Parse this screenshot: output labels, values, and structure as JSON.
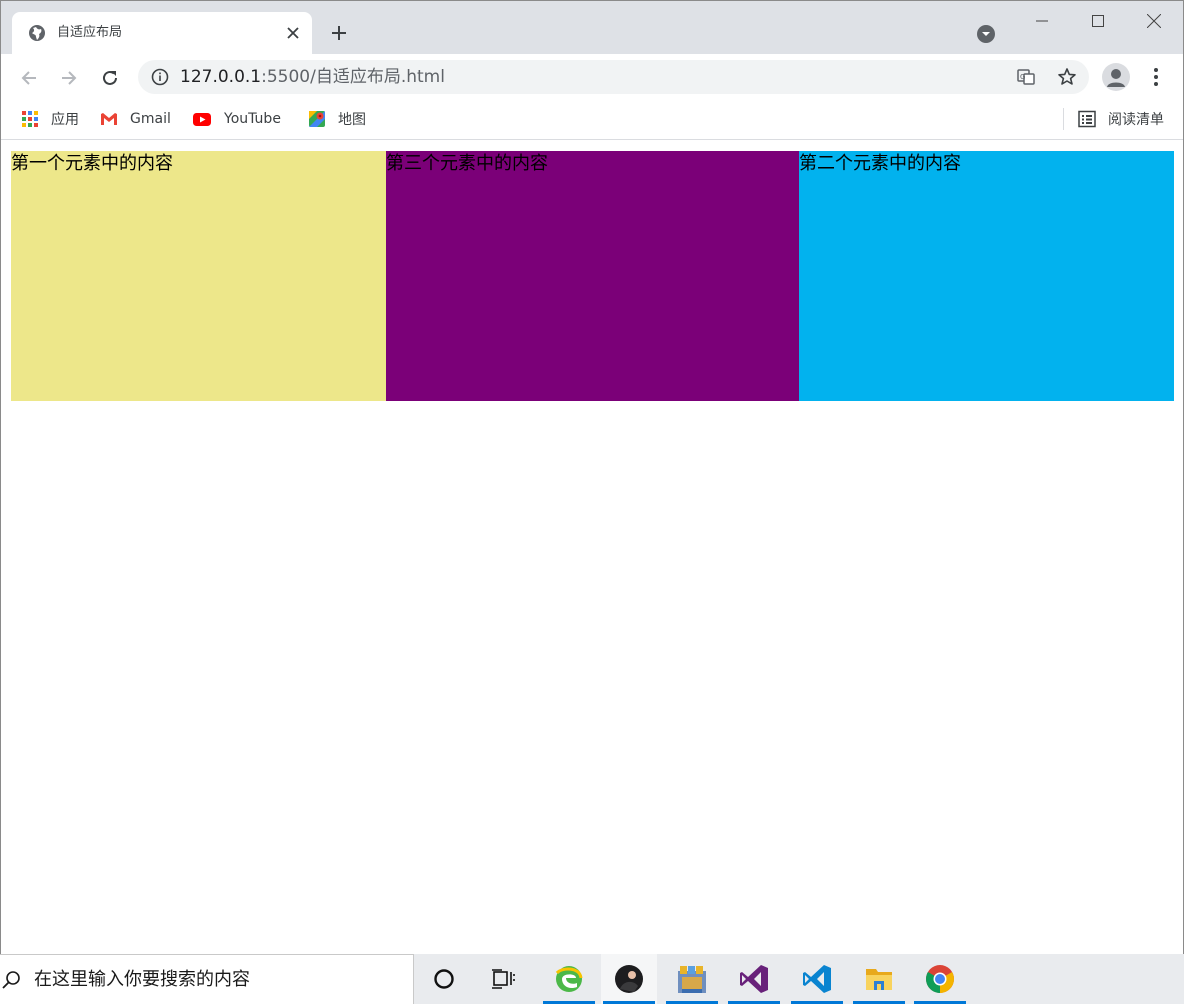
{
  "browser": {
    "tab": {
      "title": "自适应布局"
    },
    "address": {
      "host": "127.0.0.1",
      "path": ":5500/自适应布局.html"
    },
    "bookmarks": [
      {
        "label": "应用",
        "icon": "apps-grid-icon"
      },
      {
        "label": "Gmail",
        "icon": "gmail-icon"
      },
      {
        "label": "YouTube",
        "icon": "youtube-icon"
      },
      {
        "label": "地图",
        "icon": "maps-icon"
      }
    ],
    "reading_list": {
      "label": "阅读清单"
    }
  },
  "page": {
    "boxes": [
      {
        "text": "第一个元素中的内容",
        "color": "#ede78a"
      },
      {
        "text": "第三个元素中的内容",
        "color": "#7b0078"
      },
      {
        "text": "第二个元素中的内容",
        "color": "#02b2ee"
      }
    ]
  },
  "taskbar": {
    "search_placeholder": "在这里输入你要搜索的内容",
    "apps": [
      "cortana-icon",
      "task-view-icon",
      "edge-icon",
      "avatar-app-icon",
      "store-app-icon",
      "visual-studio-icon",
      "vscode-icon",
      "file-explorer-icon",
      "chrome-icon"
    ]
  }
}
